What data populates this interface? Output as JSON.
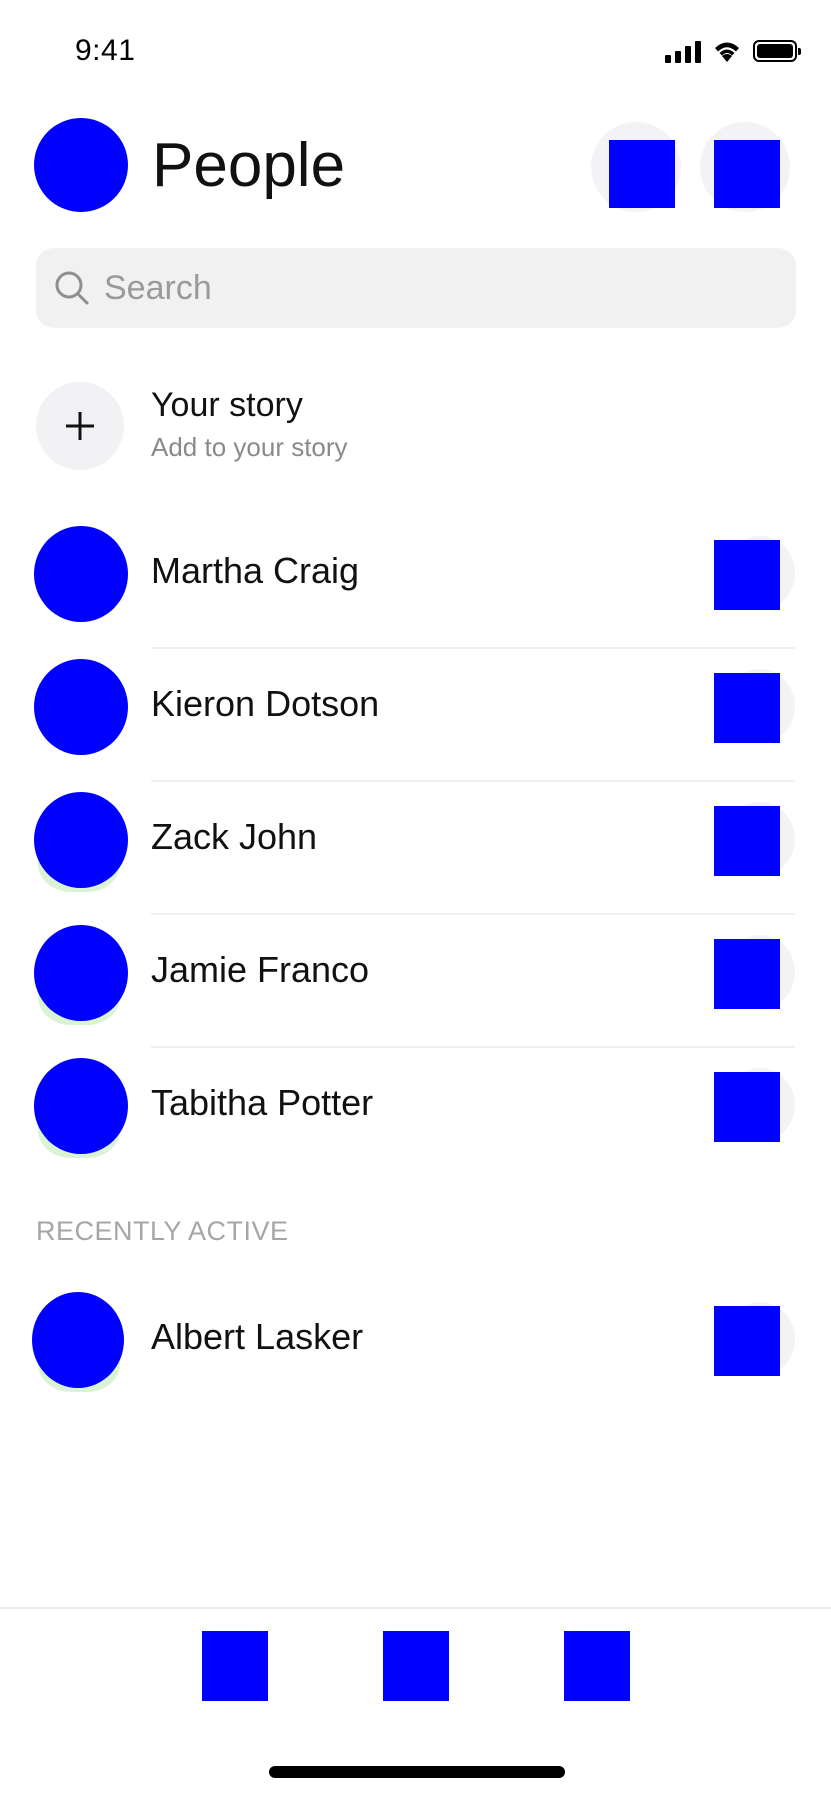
{
  "status_bar": {
    "time": "9:41"
  },
  "header": {
    "title": "People",
    "avatar_color": "#0000ff",
    "action_buttons": [
      "contacts-button",
      "new-chat-button"
    ]
  },
  "search": {
    "placeholder": "Search",
    "value": ""
  },
  "story": {
    "title": "Your story",
    "subtitle": "Add to your story",
    "icon": "plus-icon"
  },
  "contacts": [
    {
      "name": "Martha Craig"
    },
    {
      "name": "Kieron Dotson"
    },
    {
      "name": "Zack John"
    },
    {
      "name": "Jamie Franco"
    },
    {
      "name": "Tabitha Potter"
    }
  ],
  "recently_active": {
    "label": "RECENTLY ACTIVE",
    "contacts": [
      {
        "name": "Albert Lasker"
      }
    ]
  },
  "tab_bar": {
    "tabs": [
      "chats-tab",
      "people-tab",
      "discover-tab"
    ]
  },
  "colors": {
    "placeholder_blue": "#0000ff",
    "background": "#ffffff",
    "search_bg": "#f1f1f1",
    "muted_text": "#8a8a8e",
    "online_ring": "#d9f3d4"
  }
}
